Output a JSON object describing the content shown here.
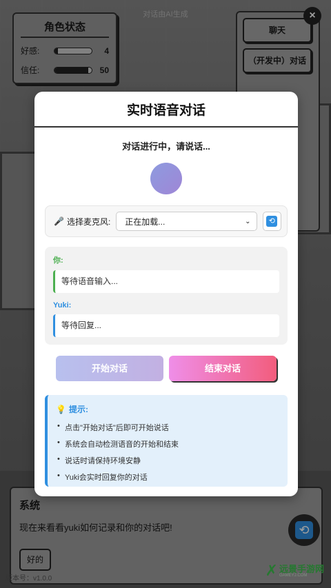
{
  "ai_note": "对话由AI生成",
  "status": {
    "title": "角色状态",
    "stats": [
      {
        "label": "好感:",
        "value": "4",
        "fill": 0.04
      },
      {
        "label": "信任:",
        "value": "50",
        "fill": 0.5
      }
    ]
  },
  "menu": {
    "items": [
      "聊天",
      "（开发中）对话"
    ]
  },
  "close_label": "×",
  "modal": {
    "title": "实时语音对话",
    "status": "对话进行中，请说话...",
    "mic_label": "选择麦克风:",
    "mic_select_value": "正在加载...",
    "you_label": "你:",
    "you_text": "等待语音输入...",
    "yuki_label": "Yuki:",
    "yuki_text": "等待回复...",
    "start_button": "开始对话",
    "end_button": "结束对话",
    "tips_title": "提示:",
    "tips": [
      "点击\"开始对话\"后即可开始说话",
      "系统会自动检测语音的开始和结束",
      "说话时请保持环境安静",
      "Yuki会实时回复你的对话"
    ]
  },
  "system": {
    "name": "系统",
    "message": "现在来看看yuki如何记录和你的对话吧!",
    "reply_button": "好的",
    "version": "版本号：v1.0.0"
  },
  "watermark": {
    "text": "远景手游网",
    "sub": "GAMEYJ.COM"
  },
  "icons": {
    "mic": "microphone-icon",
    "refresh": "refresh-icon",
    "bulb": "lightbulb-icon",
    "close": "close-icon"
  }
}
